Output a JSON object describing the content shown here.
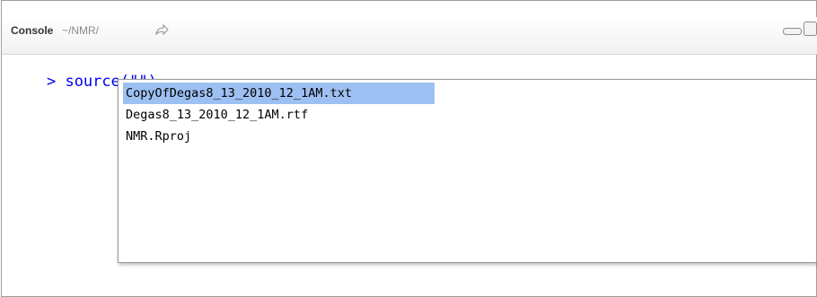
{
  "console": {
    "title": "Console",
    "path": "~/NMR/",
    "prompt": ">",
    "command": "source(\"\")"
  },
  "autocomplete": {
    "items": [
      "CopyOfDegas8_13_2010_12_1AM.txt",
      "Degas8_13_2010_12_1AM.rtf",
      "NMR.Rproj"
    ]
  }
}
